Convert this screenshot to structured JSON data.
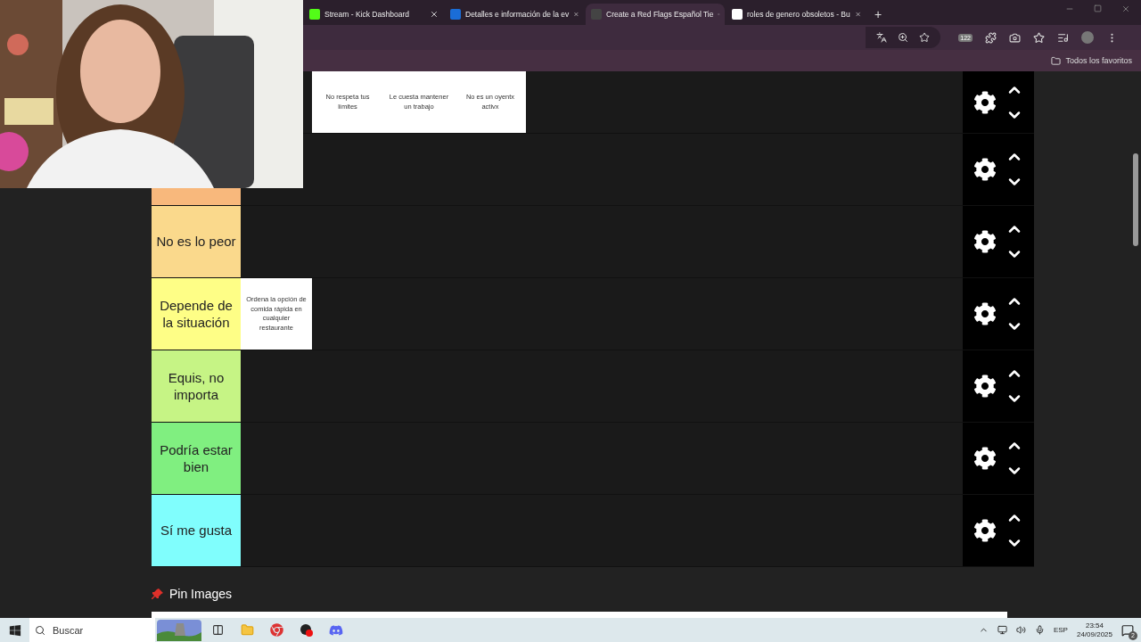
{
  "browser": {
    "tabs": [
      {
        "title": "Stream - Kick Dashboard",
        "kind": "kick",
        "selected": false
      },
      {
        "title": "Detalles e información de la ev",
        "kind": "app",
        "selected": false
      },
      {
        "title": "Create a Red Flags Español Tie",
        "kind": "tier",
        "selected": true
      },
      {
        "title": "roles de genero obsoletos - Bu",
        "kind": "google",
        "selected": false
      }
    ],
    "new_tab": "+",
    "extension_badge": "122",
    "bookmarks": [
      "Todos los favoritos"
    ]
  },
  "tier_list": {
    "tiers": [
      {
        "items": [
          "No respeta tus límites",
          "Le cuesta mantener un trabajo",
          "No es un oyentx activx"
        ]
      },
      {
        "color": "#f8b87c"
      },
      {
        "label": "No es lo peor",
        "color": "#fad98c"
      },
      {
        "label": "Depende de la situación",
        "color": "#fefe86",
        "items": [
          "Ordena la opción de comida rápida en cualquier restaurante"
        ]
      },
      {
        "label": "Equis, no importa",
        "color": "#c6f485"
      },
      {
        "label": "Podría estar bien",
        "color": "#80ef80"
      },
      {
        "label": "Sí me gusta",
        "color": "#80fefd"
      }
    ]
  },
  "pin_section": {
    "title": "Pin Images"
  },
  "taskbar": {
    "search_placeholder": "Buscar",
    "language": "ESP",
    "time": "23:54",
    "date": "24/09/2025",
    "notification_count": "2"
  }
}
